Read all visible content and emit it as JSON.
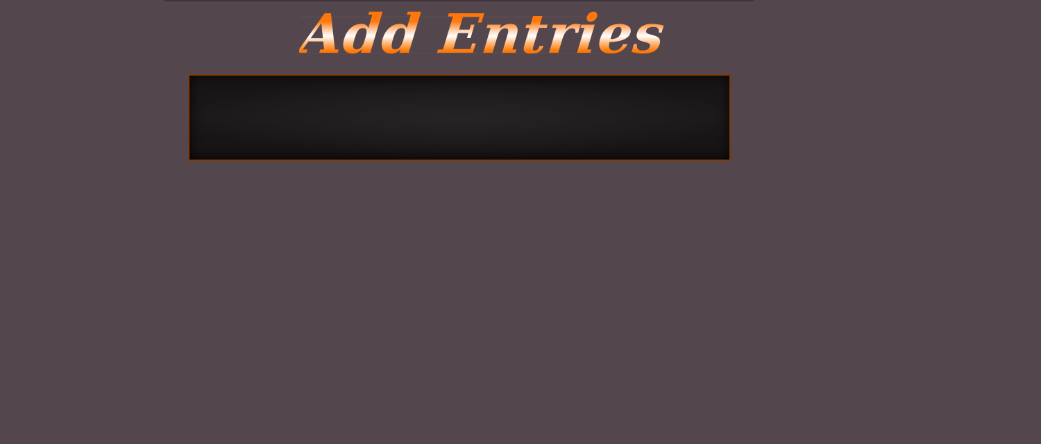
{
  "header": {
    "title": "Add Entries"
  },
  "colors": {
    "page_background": "#54464d",
    "title_accent": "#ff6e00",
    "panel_background": "#171415",
    "panel_border": "#813a0c"
  }
}
